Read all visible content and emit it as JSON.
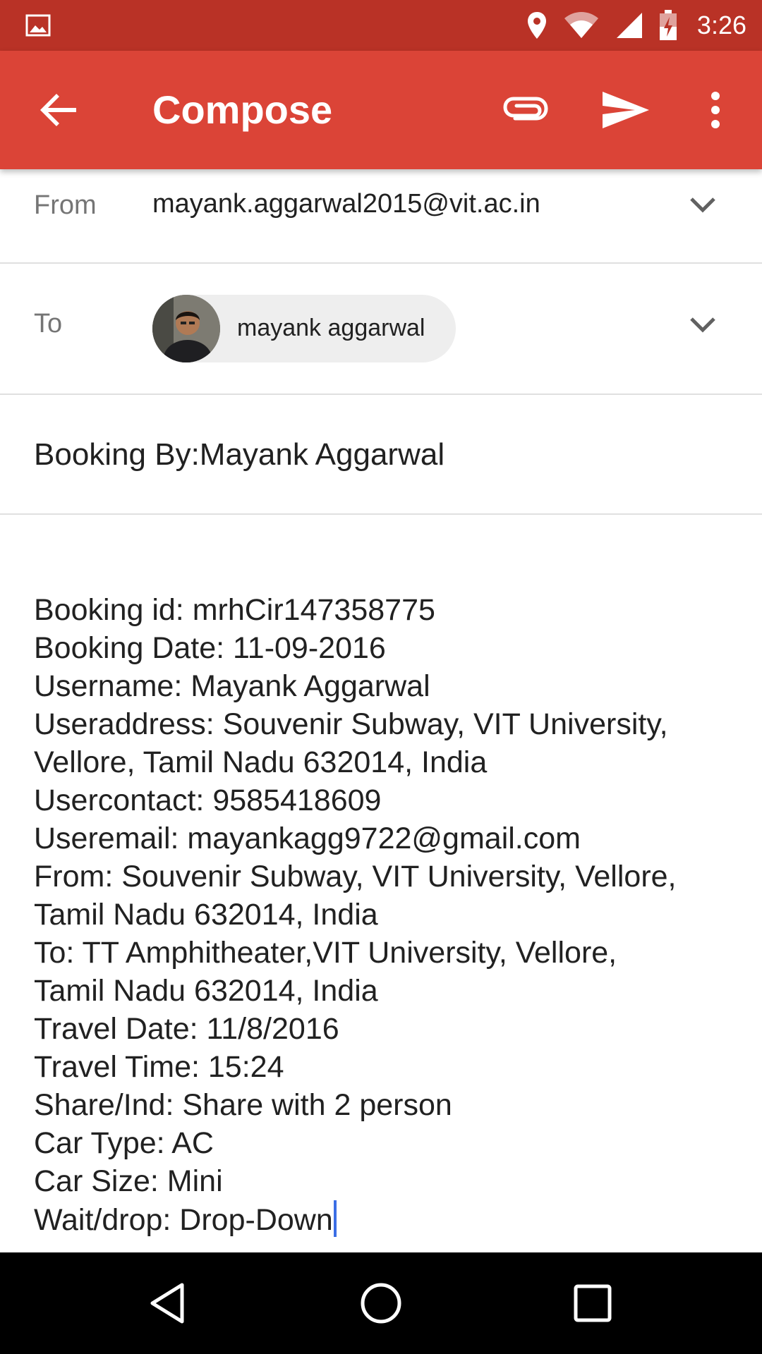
{
  "status_bar": {
    "time": "3:26",
    "icons": [
      "image-icon",
      "location-icon",
      "wifi-icon",
      "signal-icon",
      "battery-charging-icon"
    ]
  },
  "app_bar": {
    "title": "Compose",
    "actions": [
      "back-arrow-icon",
      "attach-icon",
      "send-icon",
      "more-vert-icon"
    ]
  },
  "from": {
    "label": "From",
    "value": "mayank.aggarwal2015@vit.ac.in"
  },
  "to": {
    "label": "To",
    "recipient": "mayank aggarwal"
  },
  "subject": "Booking By:Mayank Aggarwal",
  "body": {
    "lines": [
      "Booking id: mrhCir147358775",
      "Booking Date: 11-09-2016",
      "Username: Mayank Aggarwal",
      "Useraddress: Souvenir Subway, VIT University,",
      "Vellore, Tamil Nadu 632014, India",
      "Usercontact: 9585418609",
      "Useremail: mayankagg9722@gmail.com",
      "From: Souvenir Subway, VIT University, Vellore,",
      "Tamil Nadu 632014, India",
      "To: TT Amphitheater,VIT University, Vellore,",
      "Tamil Nadu 632014, India",
      "Travel Date: 11/8/2016",
      "Travel Time: 15:24",
      "Share/Ind: Share with 2 person",
      "Car Type: AC",
      "Car Size: Mini",
      "Wait/drop: Drop-Down"
    ]
  },
  "nav_bar": {
    "buttons": [
      "back-triangle-icon",
      "home-circle-icon",
      "recents-square-icon"
    ]
  },
  "colors": {
    "status_bar": "#b93226",
    "app_bar": "#db4437",
    "cursor": "#3b6ee5"
  }
}
